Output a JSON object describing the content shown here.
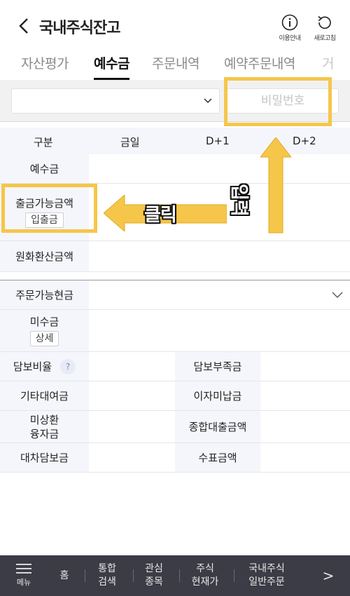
{
  "header": {
    "title": "국내주식잔고",
    "info_label": "이용안내",
    "refresh_label": "새로고침"
  },
  "tabs": [
    {
      "label": "자산평가",
      "active": false
    },
    {
      "label": "예수금",
      "active": true
    },
    {
      "label": "주문내역",
      "active": false
    },
    {
      "label": "예약주문내역",
      "active": false
    },
    {
      "label": "거",
      "active": false
    }
  ],
  "form": {
    "account_value": "",
    "password_placeholder": "비밀번호"
  },
  "table": {
    "columns": [
      "구분",
      "금일",
      "D+1",
      "D+2"
    ],
    "rows": {
      "deposit": "예수금",
      "withdrawable": "출금가능금액",
      "withdraw_button": "입출금",
      "krw_converted": "원화환산금액"
    }
  },
  "section2": {
    "title": "주문가능현금",
    "uncollected": "미수금",
    "detail_button": "상세",
    "collateral_ratio": "담보비율",
    "help_mark": "?",
    "collateral_shortage": "담보부족금",
    "other_loan": "기타대여금",
    "unpaid_interest": "이자미납금",
    "unpaid_financing_line1": "미상환",
    "unpaid_financing_line2": "융자금",
    "total_loan": "종합대출금액",
    "stock_lending_collateral": "대차담보금",
    "check_amount": "수표금액"
  },
  "annotations": {
    "click_label": "클릭",
    "input_label": "입력",
    "highlight_color": "#f6c64a"
  },
  "bottom_nav": {
    "menu_label": "메뉴",
    "home": "홈",
    "search_line1": "통합",
    "search_line2": "검색",
    "watch_line1": "관심",
    "watch_line2": "종목",
    "price_line1": "주식",
    "price_line2": "현재가",
    "order_line1": "국내주식",
    "order_line2": "일반주문",
    "next": ">"
  }
}
